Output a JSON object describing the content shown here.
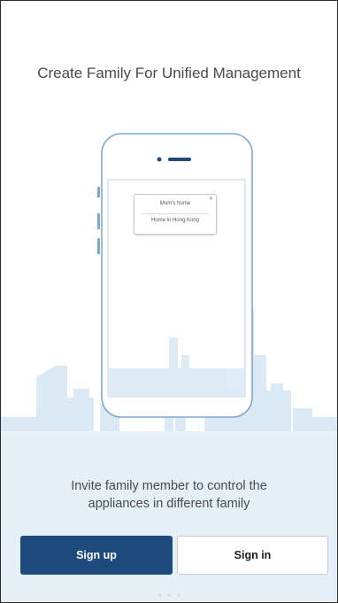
{
  "onboarding": {
    "headline": "Create Family For Unified Management",
    "popup": {
      "item_1": "Mom's home",
      "item_2": "Home in Hong Kong",
      "close_glyph": "×"
    },
    "subtitle_line_1": "Invite family member to control the",
    "subtitle_line_2": "appliances in different family",
    "signup_label": "Sign up",
    "signin_label": "Sign in",
    "page_indicator": {
      "count": 3
    }
  },
  "colors": {
    "primary": "#1e4a7e",
    "illustration": "#dbe9f5",
    "phone_outline": "#7fa8cf"
  }
}
